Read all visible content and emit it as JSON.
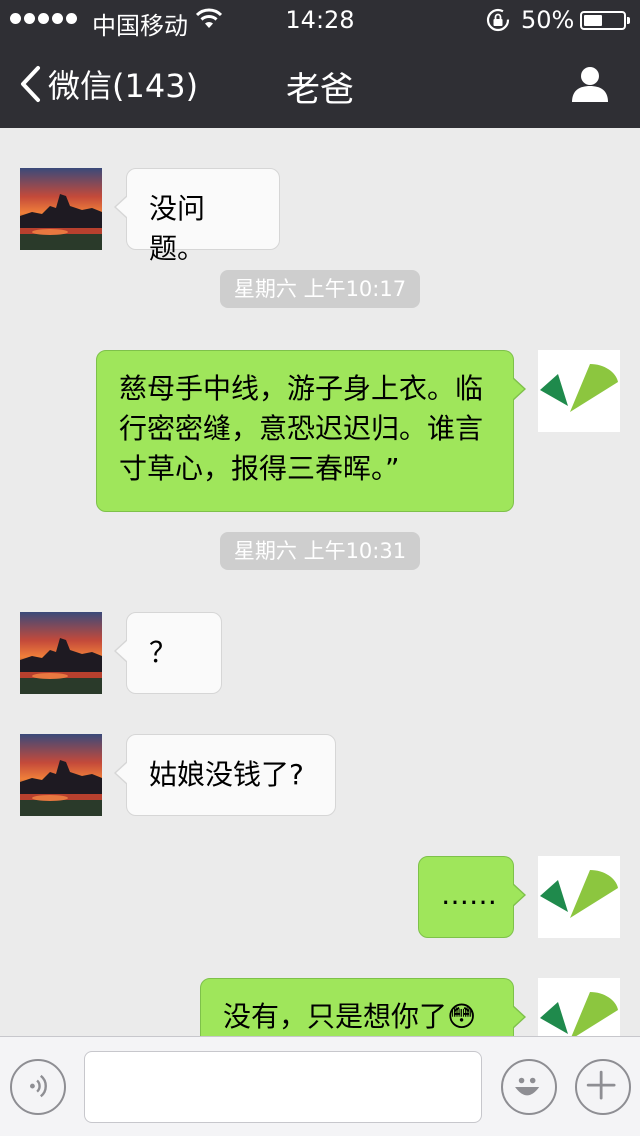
{
  "status_bar": {
    "carrier": "中国移动",
    "time": "14:28",
    "battery_percent": "50%",
    "battery_level": 0.5,
    "signal_icon": "signal-dots-icon",
    "wifi_icon": "wifi-icon",
    "lock_icon": "rotation-lock-icon"
  },
  "nav": {
    "back_label": "微信(143)",
    "title": "老爸",
    "profile_icon": "person-icon"
  },
  "messages": [
    {
      "from": "contact",
      "text": "没问题。"
    },
    {
      "type": "timestamp",
      "text": "星期六 上午10:17"
    },
    {
      "from": "me",
      "lines": [
        "慈母手中线，游子身上衣。临",
        "行密密缝，意恐迟迟归。谁言",
        "寸草心，报得三春晖。”"
      ]
    },
    {
      "type": "timestamp",
      "text": "星期六 上午10:31"
    },
    {
      "from": "contact",
      "text": "？"
    },
    {
      "from": "contact",
      "text": "姑娘没钱了?"
    },
    {
      "from": "me",
      "text": "……"
    },
    {
      "from": "me",
      "text": "没有，只是想你了",
      "emoji": "😳"
    }
  ],
  "input_bar": {
    "voice_icon": "voice-icon",
    "input_value": "",
    "emoji_icon": "smiley-icon",
    "add_icon": "plus-icon"
  },
  "colors": {
    "top_bar": "#2f2f34",
    "chat_background": "#ebebeb",
    "outgoing_bubble": "#9fe65b",
    "incoming_bubble": "#fafafa",
    "timestamp_pill": "#cecece"
  }
}
